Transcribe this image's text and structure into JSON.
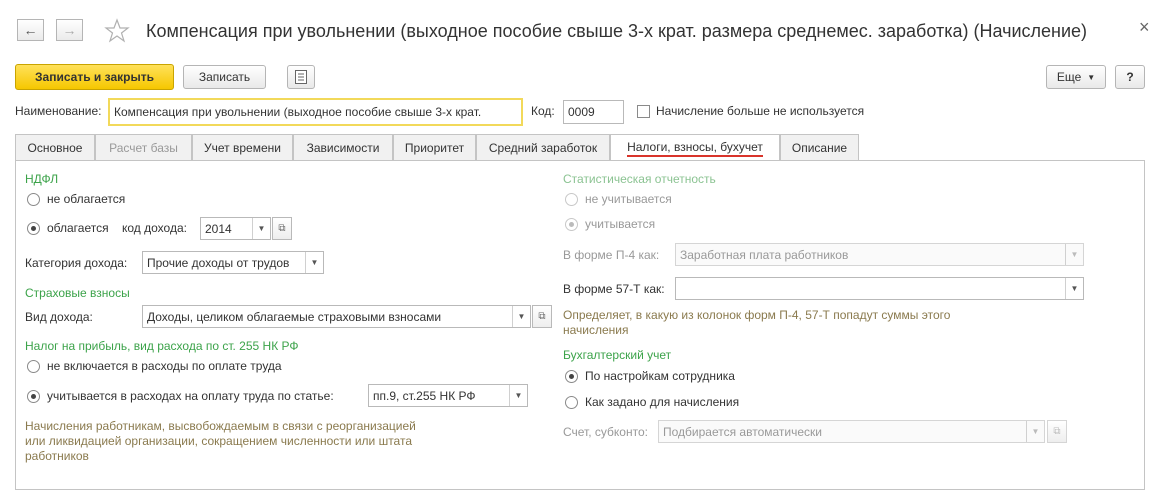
{
  "header": {
    "back_icon": "arrow-left-icon",
    "forward_icon": "arrow-right-icon",
    "star_icon": "star-icon",
    "title": "Компенсация при увольнении (выходное пособие свыше 3-х крат. размера среднемес. заработка) (Начисление)",
    "close_glyph": "×"
  },
  "toolbar": {
    "save_close_label": "Записать и закрыть",
    "save_label": "Записать",
    "list_icon": "document-list-icon",
    "more_label": "Еще",
    "help_label": "?"
  },
  "form": {
    "name_label": "Наименование:",
    "name_value": "Компенсация при увольнении (выходное пособие свыше 3-х крат.",
    "code_label": "Код:",
    "code_value": "0009",
    "not_used_label": "Начисление больше не используется"
  },
  "tabs": [
    {
      "label": "Основное"
    },
    {
      "label": "Расчет базы"
    },
    {
      "label": "Учет времени"
    },
    {
      "label": "Зависимости"
    },
    {
      "label": "Приоритет"
    },
    {
      "label": "Средний заработок"
    },
    {
      "label": "Налоги, взносы, бухучет"
    },
    {
      "label": "Описание"
    }
  ],
  "ndfl": {
    "title": "НДФЛ",
    "not_taxed_label": "не облагается",
    "taxed_label": "облагается",
    "income_code_label": "код дохода:",
    "income_code_value": "2014",
    "income_category_label": "Категория дохода:",
    "income_category_value": "Прочие доходы от трудов"
  },
  "insurance": {
    "title": "Страховые взносы",
    "income_type_label": "Вид дохода:",
    "income_type_value": "Доходы, целиком облагаемые страховыми взносами"
  },
  "profit_tax": {
    "title": "Налог на прибыль, вид расхода по ст. 255 НК РФ",
    "not_included_label": "не включается в расходы по оплате труда",
    "included_label": "учитывается в расходах на оплату труда по статье:",
    "article_value": "пп.9, ст.255 НК РФ",
    "note": "Начисления работникам, высвобождаемым в связи с реорганизацией или ликвидацией организации, сокращением численности или штата работников"
  },
  "statistics": {
    "title": "Статистическая отчетность",
    "not_counted_label": "не учитывается",
    "counted_label": "учитывается",
    "p4_label": "В форме П-4 как:",
    "p4_value": "Заработная плата работников",
    "f57t_label": "В форме 57-Т как:",
    "f57t_value": "",
    "note": "Определяет, в какую из колонок форм П-4, 57-Т попадут суммы этого начисления"
  },
  "accounting": {
    "title": "Бухгалтерский учет",
    "by_employee_label": "По настройкам сотрудника",
    "as_set_label": "Как задано для начисления",
    "account_label": "Счет, субконто:",
    "account_placeholder": "Подбирается автоматически"
  }
}
